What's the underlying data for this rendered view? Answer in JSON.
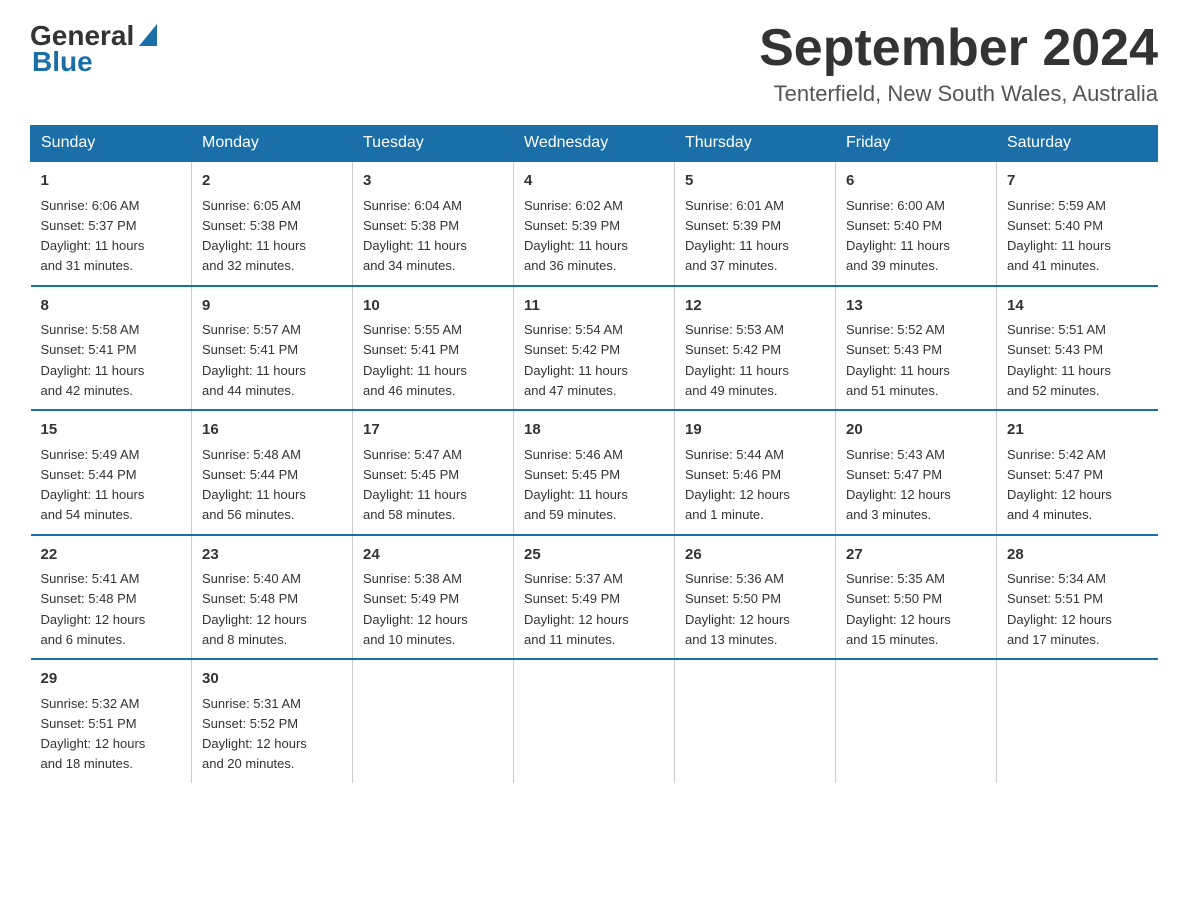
{
  "header": {
    "logo": {
      "general": "General",
      "blue": "Blue"
    },
    "title": "September 2024",
    "location": "Tenterfield, New South Wales, Australia"
  },
  "calendar": {
    "days_of_week": [
      "Sunday",
      "Monday",
      "Tuesday",
      "Wednesday",
      "Thursday",
      "Friday",
      "Saturday"
    ],
    "weeks": [
      [
        {
          "day": "1",
          "info": "Sunrise: 6:06 AM\nSunset: 5:37 PM\nDaylight: 11 hours\nand 31 minutes."
        },
        {
          "day": "2",
          "info": "Sunrise: 6:05 AM\nSunset: 5:38 PM\nDaylight: 11 hours\nand 32 minutes."
        },
        {
          "day": "3",
          "info": "Sunrise: 6:04 AM\nSunset: 5:38 PM\nDaylight: 11 hours\nand 34 minutes."
        },
        {
          "day": "4",
          "info": "Sunrise: 6:02 AM\nSunset: 5:39 PM\nDaylight: 11 hours\nand 36 minutes."
        },
        {
          "day": "5",
          "info": "Sunrise: 6:01 AM\nSunset: 5:39 PM\nDaylight: 11 hours\nand 37 minutes."
        },
        {
          "day": "6",
          "info": "Sunrise: 6:00 AM\nSunset: 5:40 PM\nDaylight: 11 hours\nand 39 minutes."
        },
        {
          "day": "7",
          "info": "Sunrise: 5:59 AM\nSunset: 5:40 PM\nDaylight: 11 hours\nand 41 minutes."
        }
      ],
      [
        {
          "day": "8",
          "info": "Sunrise: 5:58 AM\nSunset: 5:41 PM\nDaylight: 11 hours\nand 42 minutes."
        },
        {
          "day": "9",
          "info": "Sunrise: 5:57 AM\nSunset: 5:41 PM\nDaylight: 11 hours\nand 44 minutes."
        },
        {
          "day": "10",
          "info": "Sunrise: 5:55 AM\nSunset: 5:41 PM\nDaylight: 11 hours\nand 46 minutes."
        },
        {
          "day": "11",
          "info": "Sunrise: 5:54 AM\nSunset: 5:42 PM\nDaylight: 11 hours\nand 47 minutes."
        },
        {
          "day": "12",
          "info": "Sunrise: 5:53 AM\nSunset: 5:42 PM\nDaylight: 11 hours\nand 49 minutes."
        },
        {
          "day": "13",
          "info": "Sunrise: 5:52 AM\nSunset: 5:43 PM\nDaylight: 11 hours\nand 51 minutes."
        },
        {
          "day": "14",
          "info": "Sunrise: 5:51 AM\nSunset: 5:43 PM\nDaylight: 11 hours\nand 52 minutes."
        }
      ],
      [
        {
          "day": "15",
          "info": "Sunrise: 5:49 AM\nSunset: 5:44 PM\nDaylight: 11 hours\nand 54 minutes."
        },
        {
          "day": "16",
          "info": "Sunrise: 5:48 AM\nSunset: 5:44 PM\nDaylight: 11 hours\nand 56 minutes."
        },
        {
          "day": "17",
          "info": "Sunrise: 5:47 AM\nSunset: 5:45 PM\nDaylight: 11 hours\nand 58 minutes."
        },
        {
          "day": "18",
          "info": "Sunrise: 5:46 AM\nSunset: 5:45 PM\nDaylight: 11 hours\nand 59 minutes."
        },
        {
          "day": "19",
          "info": "Sunrise: 5:44 AM\nSunset: 5:46 PM\nDaylight: 12 hours\nand 1 minute."
        },
        {
          "day": "20",
          "info": "Sunrise: 5:43 AM\nSunset: 5:47 PM\nDaylight: 12 hours\nand 3 minutes."
        },
        {
          "day": "21",
          "info": "Sunrise: 5:42 AM\nSunset: 5:47 PM\nDaylight: 12 hours\nand 4 minutes."
        }
      ],
      [
        {
          "day": "22",
          "info": "Sunrise: 5:41 AM\nSunset: 5:48 PM\nDaylight: 12 hours\nand 6 minutes."
        },
        {
          "day": "23",
          "info": "Sunrise: 5:40 AM\nSunset: 5:48 PM\nDaylight: 12 hours\nand 8 minutes."
        },
        {
          "day": "24",
          "info": "Sunrise: 5:38 AM\nSunset: 5:49 PM\nDaylight: 12 hours\nand 10 minutes."
        },
        {
          "day": "25",
          "info": "Sunrise: 5:37 AM\nSunset: 5:49 PM\nDaylight: 12 hours\nand 11 minutes."
        },
        {
          "day": "26",
          "info": "Sunrise: 5:36 AM\nSunset: 5:50 PM\nDaylight: 12 hours\nand 13 minutes."
        },
        {
          "day": "27",
          "info": "Sunrise: 5:35 AM\nSunset: 5:50 PM\nDaylight: 12 hours\nand 15 minutes."
        },
        {
          "day": "28",
          "info": "Sunrise: 5:34 AM\nSunset: 5:51 PM\nDaylight: 12 hours\nand 17 minutes."
        }
      ],
      [
        {
          "day": "29",
          "info": "Sunrise: 5:32 AM\nSunset: 5:51 PM\nDaylight: 12 hours\nand 18 minutes."
        },
        {
          "day": "30",
          "info": "Sunrise: 5:31 AM\nSunset: 5:52 PM\nDaylight: 12 hours\nand 20 minutes."
        },
        null,
        null,
        null,
        null,
        null
      ]
    ]
  }
}
